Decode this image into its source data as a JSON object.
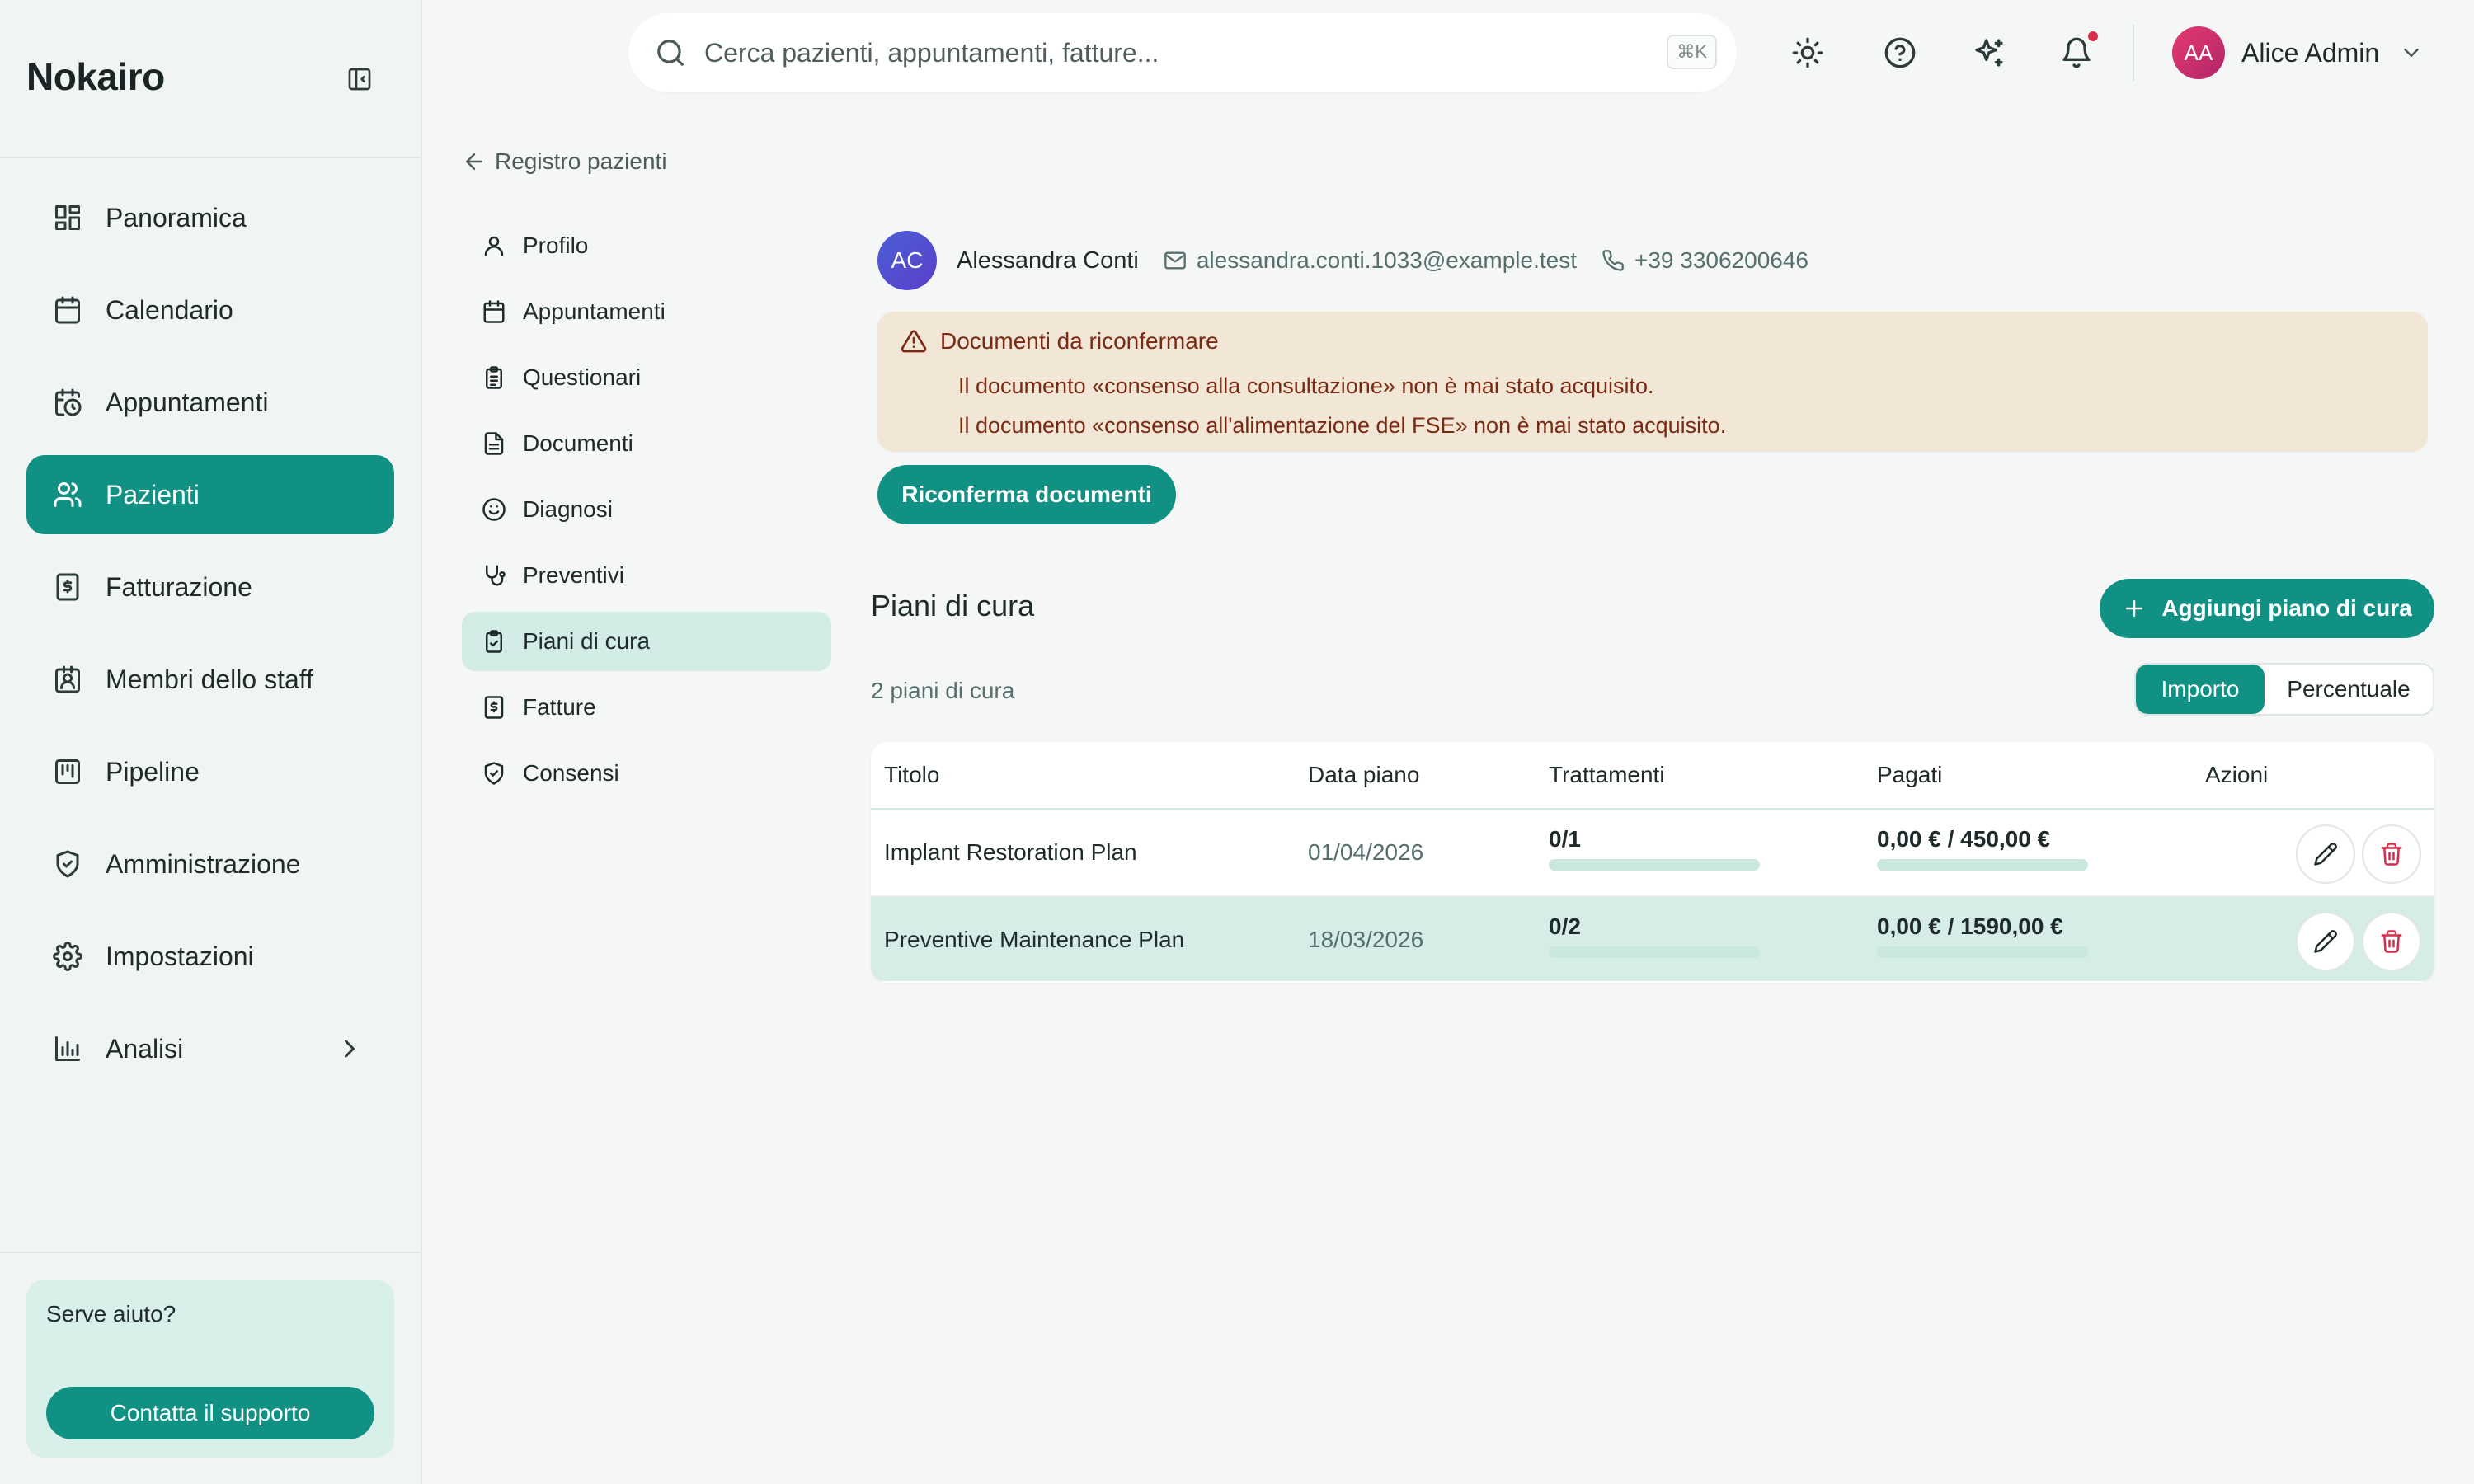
{
  "app": {
    "name": "Nokairo"
  },
  "sidebar": {
    "items": [
      {
        "label": "Panoramica",
        "icon": "dashboard-icon"
      },
      {
        "label": "Calendario",
        "icon": "calendar-icon"
      },
      {
        "label": "Appuntamenti",
        "icon": "calendar-clock-icon"
      },
      {
        "label": "Pazienti",
        "icon": "users-icon",
        "active": true
      },
      {
        "label": "Fatturazione",
        "icon": "receipt-icon"
      },
      {
        "label": "Membri dello staff",
        "icon": "badge-icon"
      },
      {
        "label": "Pipeline",
        "icon": "kanban-icon"
      },
      {
        "label": "Amministrazione",
        "icon": "shield-icon"
      },
      {
        "label": "Impostazioni",
        "icon": "gear-icon"
      },
      {
        "label": "Analisi",
        "icon": "chart-icon",
        "has_submenu": true
      }
    ],
    "help": {
      "title": "Serve aiuto?",
      "button": "Contatta il supporto"
    }
  },
  "topbar": {
    "search_placeholder": "Cerca pazienti, appuntamenti, fatture...",
    "shortcut": "⌘K",
    "user_initials": "AA",
    "user_name": "Alice Admin"
  },
  "patient_nav": {
    "back_label": "Registro pazienti",
    "items": [
      {
        "label": "Profilo",
        "icon": "user-icon"
      },
      {
        "label": "Appuntamenti",
        "icon": "calendar-icon"
      },
      {
        "label": "Questionari",
        "icon": "clipboard-list-icon"
      },
      {
        "label": "Documenti",
        "icon": "file-icon"
      },
      {
        "label": "Diagnosi",
        "icon": "smile-icon"
      },
      {
        "label": "Preventivi",
        "icon": "stethoscope-icon"
      },
      {
        "label": "Piani di cura",
        "icon": "clipboard-check-icon",
        "active": true
      },
      {
        "label": "Fatture",
        "icon": "receipt-icon"
      },
      {
        "label": "Consensi",
        "icon": "shield-check-icon"
      }
    ]
  },
  "patient": {
    "initials": "AC",
    "name": "Alessandra Conti",
    "email": "alessandra.conti.1033@example.test",
    "phone": "+39 3306200646"
  },
  "alert": {
    "title": "Documenti da riconfermare",
    "lines": [
      "Il documento «consenso alla consultazione» non è mai stato acquisito.",
      "Il documento «consenso all'alimentazione del FSE» non è mai stato acquisito."
    ],
    "button": "Riconferma documenti"
  },
  "plans": {
    "title": "Piani di cura",
    "add_button": "Aggiungi piano di cura",
    "count_label": "2 piani di cura",
    "toggle": {
      "amount": "Importo",
      "percent": "Percentuale",
      "selected": "amount"
    },
    "columns": [
      "Titolo",
      "Data piano",
      "Trattamenti",
      "Pagati",
      "Azioni"
    ],
    "rows": [
      {
        "title": "Implant Restoration Plan",
        "date": "01/04/2026",
        "treatments": "0/1",
        "treatments_progress": 0,
        "paid": "0,00 € / 450,00 €",
        "paid_progress": 0
      },
      {
        "title": "Preventive Maintenance Plan",
        "date": "18/03/2026",
        "treatments": "0/2",
        "treatments_progress": 0,
        "paid": "0,00 € / 1590,00 €",
        "paid_progress": 0
      }
    ]
  },
  "colors": {
    "accent": "#119184",
    "alert_bg": "#f2e6d6",
    "alert_text": "#7a2a12",
    "danger": "#d32f4a"
  }
}
